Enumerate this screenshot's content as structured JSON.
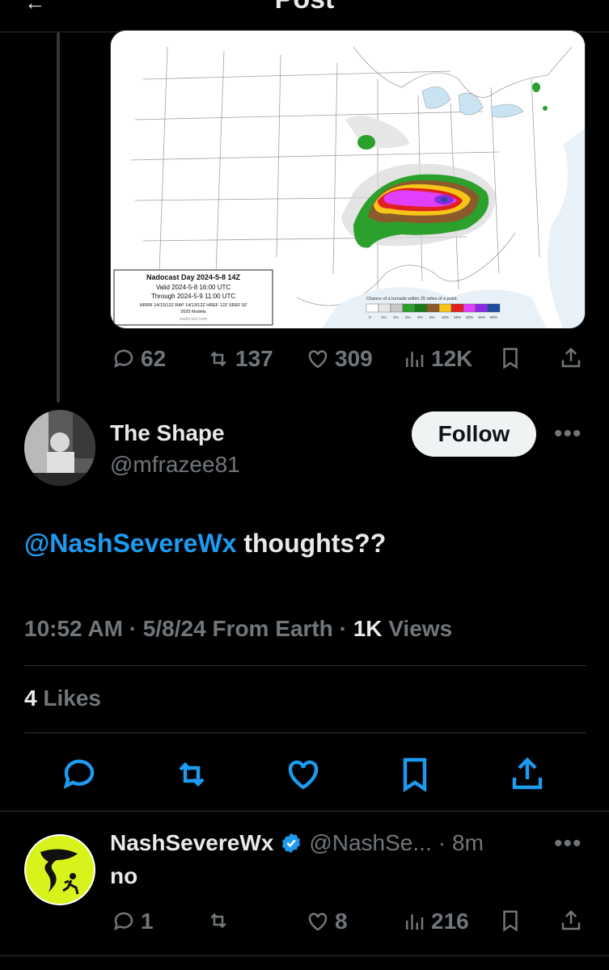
{
  "header": {
    "title": "Post",
    "back_icon": "back-arrow-icon"
  },
  "quoted_tweet": {
    "map": {
      "legend_title": "Nadocast Day 2024-5-8 14Z",
      "valid": "Valid 2024-5-8 16:00 UTC",
      "through": "Through 2024-5-9 11:00 UTC",
      "models": "HRRR 14/13/12Z RAP 14/13/12Z HREF 12Z SREF 9Z",
      "models2": "2020 Models",
      "site": "nadocast.com",
      "scale_title": "Chance of a tornado within 25 miles of a point.",
      "scale_labels": [
        "0",
        "1%",
        "1%",
        "2%",
        "3%",
        "5%",
        "10%",
        "15%",
        "30%",
        "45%",
        "60%"
      ],
      "scale_colors": [
        "#ffffff",
        "#e6e6e6",
        "#c8c8c8",
        "#2ca02c",
        "#1a7a1a",
        "#8b5a2b",
        "#f5c518",
        "#e02020",
        "#e040fb",
        "#8a2be2",
        "#1f4e9c"
      ]
    },
    "actions": {
      "replies": "62",
      "reposts": "137",
      "likes": "309",
      "views": "12K"
    }
  },
  "main_tweet": {
    "display_name": "The Shape",
    "handle": "@mfrazee81",
    "follow_label": "Follow",
    "mention": "@NashSevereWx",
    "text": " thoughts??",
    "time": "10:52 AM",
    "date": "5/8/24",
    "source": "From Earth",
    "views_count": "1K",
    "views_label": "Views",
    "likes_count": "4",
    "likes_label": "Likes"
  },
  "reply": {
    "display_name": "NashSevereWx",
    "handle": "@NashSe...",
    "age": "8m",
    "text": "no",
    "actions": {
      "replies": "1",
      "reposts": "",
      "likes": "8",
      "views": "216"
    }
  },
  "colors": {
    "accent": "#1d9bf0",
    "background": "#000000",
    "verified": "#1d9bf0",
    "nash_avatar": "#d8f31c"
  }
}
